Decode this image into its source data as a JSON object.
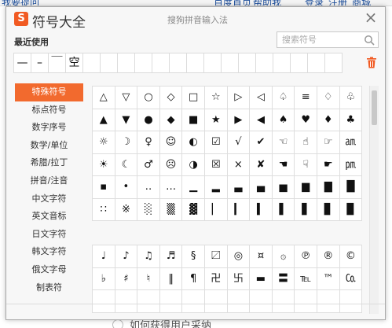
{
  "background": {
    "top_links": [
      "我要提问",
      "百度首页",
      "帮助我",
      "登录",
      "注册",
      "商城"
    ],
    "bottom_question": "如何获得用户采纳"
  },
  "window": {
    "app_title": "符号大全",
    "logo_letter": "S",
    "ime_name": "搜狗拼音输入法",
    "close_glyph": "×",
    "recent_label": "最近使用",
    "search_placeholder": "搜索符号",
    "recent_symbols": [
      "—",
      "–",
      "￣",
      "空",
      "",
      "",
      "",
      "",
      "",
      "",
      "",
      "",
      "",
      "",
      "",
      "",
      "",
      "",
      ""
    ]
  },
  "categories": [
    "特殊符号",
    "标点符号",
    "数字序号",
    "数学/单位",
    "希腊/拉丁",
    "拼音/注音",
    "中文字符",
    "英文音标",
    "日文字符",
    "韩文字符",
    "俄文字母",
    "制表符"
  ],
  "active_category": "特殊符号",
  "grid_top": [
    [
      "△",
      "▽",
      "○",
      "◇",
      "□",
      "☆",
      "▷",
      "◁",
      "♤",
      "≡",
      "♢",
      "♧"
    ],
    [
      "▲",
      "▼",
      "●",
      "◆",
      "■",
      "★",
      "▶",
      "◀",
      "♠",
      "♥",
      "♦",
      "♣"
    ],
    [
      "☼",
      "☽",
      "♀",
      "☺",
      "◐",
      "☑",
      "√",
      "✔",
      "☜",
      "☝",
      "☞",
      "㏂"
    ],
    [
      "☀",
      "☾",
      "♂",
      "☹",
      "◑",
      "☒",
      "×",
      "✘",
      "☚",
      "☟",
      "☛",
      "㏘"
    ],
    [
      "▪",
      "•",
      "‥",
      "…",
      "▁",
      "▂",
      "▃",
      "▄",
      "▅",
      "▆",
      "▇",
      "█"
    ],
    [
      "∷",
      "※",
      "░",
      "▒",
      "▓",
      "▏",
      "▎",
      "▍",
      "▌",
      "▋",
      "▊",
      "▉"
    ]
  ],
  "grid_bottom": [
    [
      "♩",
      "♪",
      "♫",
      "♬",
      "§",
      "〼",
      "◎",
      "¤",
      "۞",
      "℗",
      "®",
      "©"
    ],
    [
      "♭",
      "♯",
      "♮",
      "‖",
      "¶",
      "卍",
      "卐",
      "▬",
      "〓",
      "℡",
      "™",
      "㏇"
    ],
    [
      "",
      "",
      "",
      "",
      "",
      "",
      "",
      "",
      "",
      "",
      "",
      ""
    ]
  ]
}
